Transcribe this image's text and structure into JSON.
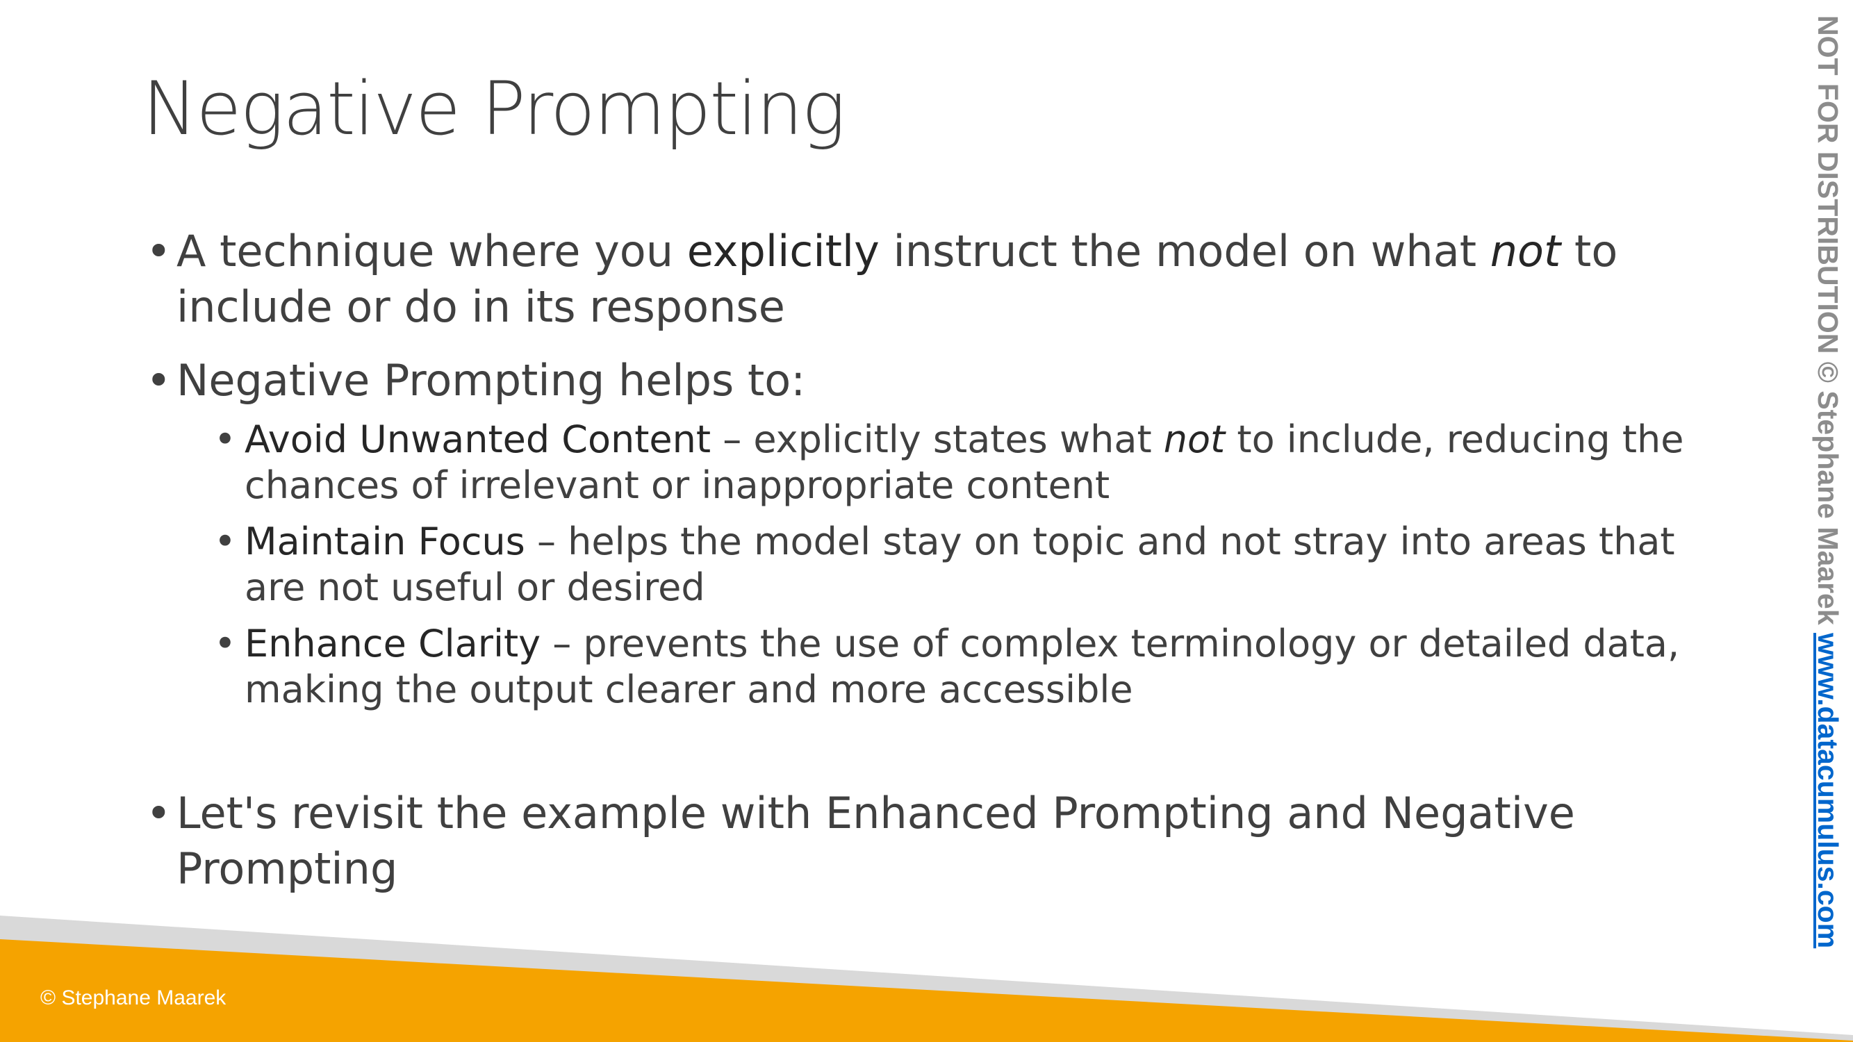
{
  "slide": {
    "title": "Negative Prompting",
    "bullet1": {
      "pre": "A technique where you ",
      "em": "explicitly",
      "mid": " instruct the model on what ",
      "italic": "not",
      "post": " to include or do in its response"
    },
    "bullet2": "Negative Prompting helps to:",
    "sub_items": [
      {
        "term": "Avoid Unwanted Content",
        "pre": " – explicitly states what ",
        "italic": "not",
        "post": " to include, reducing the chances of irrelevant or inappropriate content"
      },
      {
        "term": "Maintain Focus",
        "desc": " – helps the model stay on topic and not stray into areas that are not useful or desired"
      },
      {
        "term": "Enhance Clarity",
        "desc": " – prevents the use of complex terminology or detailed data, making the output clearer and more accessible"
      }
    ],
    "bullet3": "Let's revisit the example with Enhanced Prompting and Negative Prompting"
  },
  "footer": {
    "copyright": "© Stephane Maarek"
  },
  "side_banner": {
    "text": "NOT FOR DISTRIBUTION © Stephane Maarek ",
    "link": "www.datacumulus.com"
  },
  "colors": {
    "text": "#404040",
    "accent_orange": "#F5A300",
    "stripe_gray": "#D9D9D9",
    "link_blue": "#0066CC",
    "watermark_gray": "#8C8C8C"
  }
}
